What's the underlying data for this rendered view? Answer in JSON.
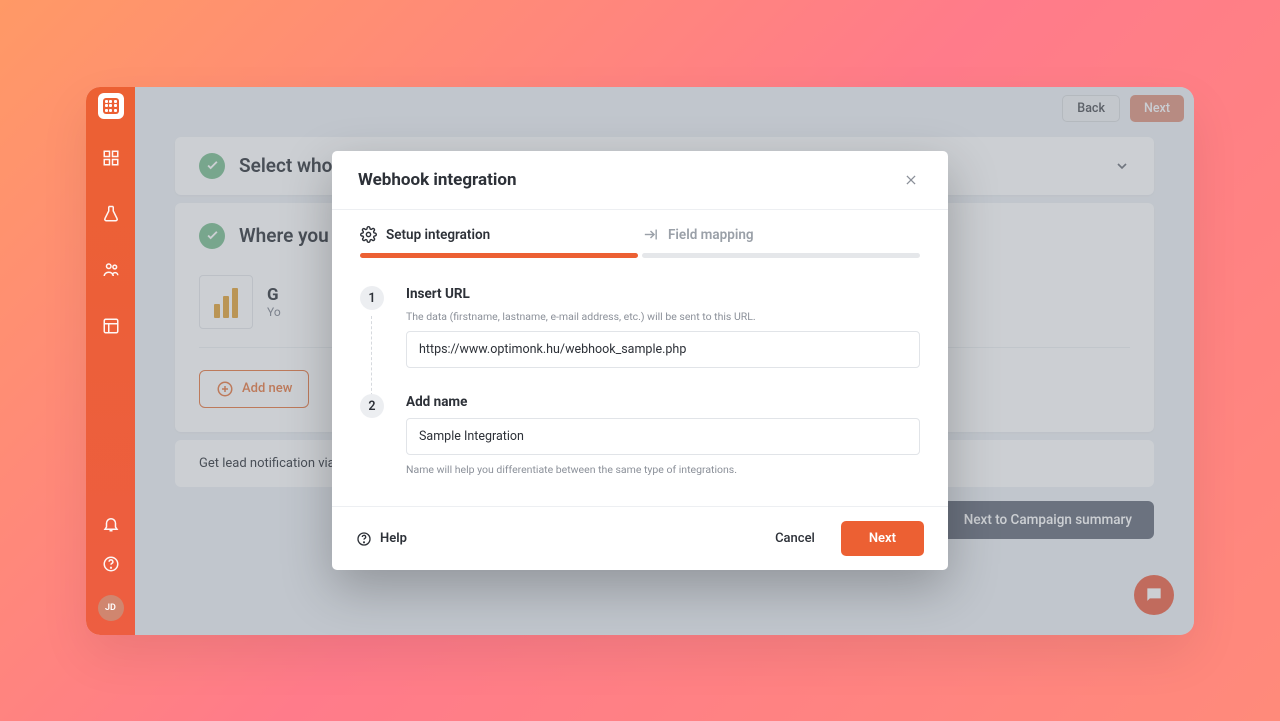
{
  "topButtons": {
    "back": "Back",
    "next": "Next"
  },
  "sidebar": {
    "avatar": "JD"
  },
  "sections": {
    "s1": {
      "title": "Select who should see it"
    },
    "s2": {
      "title": "Where you",
      "integration": {
        "initial": "G",
        "subPrefix": "Yo"
      },
      "addNew": "Add new"
    },
    "nextSummary": "Next to Campaign summary",
    "lead": "Get lead notification via em"
  },
  "modal": {
    "title": "Webhook integration",
    "steps": {
      "setup": "Setup integration",
      "mapping": "Field mapping"
    },
    "step1": {
      "num": "1",
      "label": "Insert URL",
      "hint": "The data (firstname, lastname, e-mail address, etc.) will be sent to this URL.",
      "value": "https://www.optimonk.hu/webhook_sample.php"
    },
    "step2": {
      "num": "2",
      "label": "Add name",
      "value": "Sample Integration",
      "hint2": "Name will help you differentiate between the same type of integrations."
    },
    "footer": {
      "help": "Help",
      "cancel": "Cancel",
      "next": "Next"
    }
  }
}
